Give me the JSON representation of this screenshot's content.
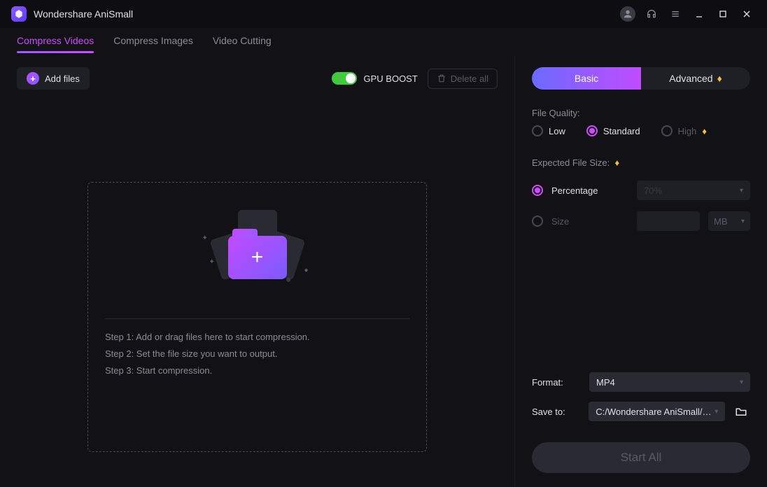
{
  "app": {
    "name": "Wondershare AniSmall"
  },
  "tabs": [
    {
      "label": "Compress Videos",
      "active": true
    },
    {
      "label": "Compress Images",
      "active": false
    },
    {
      "label": "Video Cutting",
      "active": false
    }
  ],
  "toolbar": {
    "add_files_label": "Add files",
    "gpu_label": "GPU BOOST",
    "gpu_enabled": true,
    "delete_all_label": "Delete all"
  },
  "dropzone": {
    "step1": "Step 1: Add or drag files here to start compression.",
    "step2": "Step 2: Set the file size you want to output.",
    "step3": "Step 3: Start compression."
  },
  "settings": {
    "mode": {
      "basic_label": "Basic",
      "advanced_label": "Advanced",
      "selected": "basic"
    },
    "file_quality": {
      "label": "File Quality:",
      "low": "Low",
      "standard": "Standard",
      "high": "High",
      "selected": "standard"
    },
    "expected": {
      "label": "Expected File Size:",
      "percentage_label": "Percentage",
      "size_label": "Size",
      "selected": "percentage",
      "percentage_value": "70%",
      "size_value": "",
      "size_unit": "MB"
    },
    "format": {
      "label": "Format:",
      "value": "MP4"
    },
    "save_to": {
      "label": "Save to:",
      "value": "C:/Wondershare AniSmall/Com"
    },
    "start_all_label": "Start All"
  }
}
